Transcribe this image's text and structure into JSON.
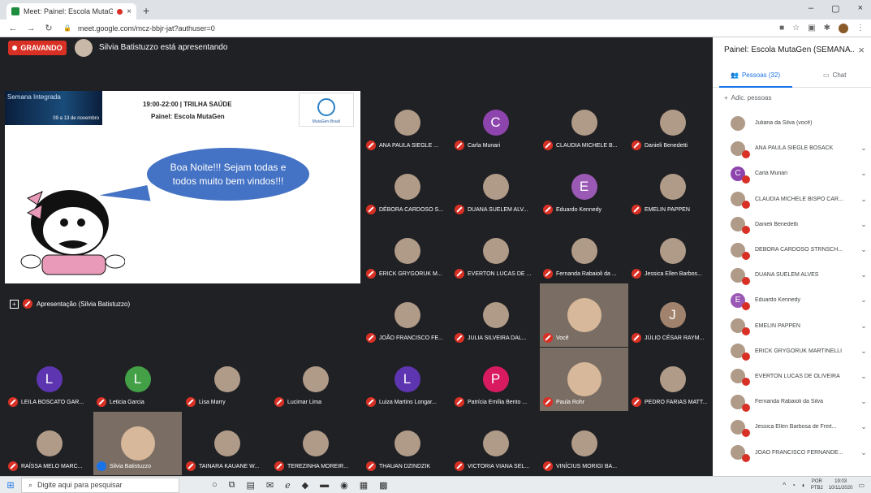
{
  "browser": {
    "tab_title": "Meet: Painel: Escola MutaGen",
    "tab_close": "×",
    "new_tab": "+",
    "url": "meet.google.com/mcz-bbjr-jat?authuser=0",
    "win_min": "–",
    "win_max": "▢",
    "win_close": "×"
  },
  "stage": {
    "recording_label": "GRAVANDO",
    "presenting_text": "Silvia Batistuzzo está apresentando",
    "presentation_label": "Apresentação (Silvia Batistuzzo)"
  },
  "slide": {
    "banner_text": "Semana Integrada",
    "banner_date": "09 a 13 de novembro",
    "time_track": "19:00-22:00 | TRILHA SAÚDE",
    "panel": "Painel: Escola MutaGen",
    "logo_text": "MutaGen-Brasil",
    "bubble": "Boa Noite!!! Sejam todas e todos muito bem vindos!!!"
  },
  "tiles": [
    {
      "name": "ANA PAULA SIEGLE ...",
      "initial": "",
      "color": ""
    },
    {
      "name": "Carla Munari",
      "initial": "C",
      "color": "#8e44ad"
    },
    {
      "name": "CLAUDIA MICHELE B...",
      "initial": "",
      "color": ""
    },
    {
      "name": "Danieli Benedetti",
      "initial": "",
      "color": ""
    },
    {
      "name": "DÉBORA CARDOSO S...",
      "initial": "",
      "color": ""
    },
    {
      "name": "DUANA SUELEM ALV...",
      "initial": "",
      "color": ""
    },
    {
      "name": "Eduardo Kennedy",
      "initial": "E",
      "color": "#9b59b6"
    },
    {
      "name": "EMELIN PAPPEN",
      "initial": "",
      "color": ""
    },
    {
      "name": "ERICK GRYGORUK M...",
      "initial": "",
      "color": ""
    },
    {
      "name": "EVERTON LUCAS DE ...",
      "initial": "",
      "color": ""
    },
    {
      "name": "Fernanda Rabaioli da ...",
      "initial": "",
      "color": ""
    },
    {
      "name": "Jessica Ellen Barbos...",
      "initial": "",
      "color": ""
    },
    {
      "name": "JOÃO FRANCISCO FE...",
      "initial": "",
      "color": ""
    },
    {
      "name": "JULIA SILVEIRA DAL...",
      "initial": "",
      "color": ""
    },
    {
      "name": "Você",
      "initial": "",
      "color": ""
    },
    {
      "name": "JÚLIO CÉSAR RAYM...",
      "initial": "J",
      "color": "#a0826d"
    },
    {
      "name": "LEILA BOSCATO GAR...",
      "initial": "L",
      "color": "#5e35b1"
    },
    {
      "name": "Leticia Garcia",
      "initial": "L",
      "color": "#43a047"
    },
    {
      "name": "Lisa Marry",
      "initial": "",
      "color": ""
    },
    {
      "name": "Lucimar Lima",
      "initial": "",
      "color": ""
    },
    {
      "name": "Luiza Martins Longar...",
      "initial": "L",
      "color": "#5e35b1"
    },
    {
      "name": "Patrícia Emília Bento ...",
      "initial": "P",
      "color": "#d81b60"
    },
    {
      "name": "Paula Rohr",
      "initial": "",
      "color": ""
    },
    {
      "name": "PEDRO FARIAS MATT...",
      "initial": "",
      "color": ""
    },
    {
      "name": "RAÍSSA MELO MARC...",
      "initial": "",
      "color": ""
    },
    {
      "name": "Silvia Batistuzzo",
      "initial": "",
      "color": ""
    },
    {
      "name": "TAINARA KAUANE W...",
      "initial": "",
      "color": ""
    },
    {
      "name": "TEREZINHA MOREIR...",
      "initial": "",
      "color": ""
    },
    {
      "name": "THAUAN DZINDZIK",
      "initial": "",
      "color": ""
    },
    {
      "name": "VICTORIA VIANA SEL...",
      "initial": "",
      "color": ""
    },
    {
      "name": "VINÍCIUS MORIGI BA...",
      "initial": "",
      "color": ""
    }
  ],
  "panel": {
    "title": "Painel: Escola MutaGen (SEMANA...",
    "close": "×",
    "people_tab": "Pessoas (32)",
    "chat_tab": "Chat",
    "add_people": "Adic. pessoas",
    "people": [
      {
        "name": "Juliana da Silva (você)",
        "initial": "",
        "color": ""
      },
      {
        "name": "ANA PAULA SIEGLE BOSACK",
        "initial": "",
        "color": ""
      },
      {
        "name": "Carla Munari",
        "initial": "C",
        "color": "#8e44ad"
      },
      {
        "name": "CLAUDIA MICHELE BISPO CAR...",
        "initial": "",
        "color": ""
      },
      {
        "name": "Danieli Benedetti",
        "initial": "",
        "color": ""
      },
      {
        "name": "DÉBORA CARDOSO STRNSCH...",
        "initial": "",
        "color": ""
      },
      {
        "name": "DUANA SUELEM ALVES",
        "initial": "",
        "color": ""
      },
      {
        "name": "Eduardo Kennedy",
        "initial": "E",
        "color": "#9b59b6"
      },
      {
        "name": "EMELIN PAPPEN",
        "initial": "",
        "color": ""
      },
      {
        "name": "ERICK GRYGORUK MARTINELLI",
        "initial": "",
        "color": ""
      },
      {
        "name": "EVERTON LUCAS DE OLIVEIRA",
        "initial": "",
        "color": ""
      },
      {
        "name": "Fernanda Rabaioli da Silva",
        "initial": "",
        "color": ""
      },
      {
        "name": "Jessica Ellen Barbosa de Freit...",
        "initial": "",
        "color": ""
      },
      {
        "name": "JOÃO FRANCISCO FERNANDE...",
        "initial": "",
        "color": ""
      }
    ]
  },
  "taskbar": {
    "search_placeholder": "Digite aqui para pesquisar",
    "lang_top": "POR",
    "lang_bottom": "PTB2",
    "time": "19:03",
    "date": "10/11/2020"
  }
}
